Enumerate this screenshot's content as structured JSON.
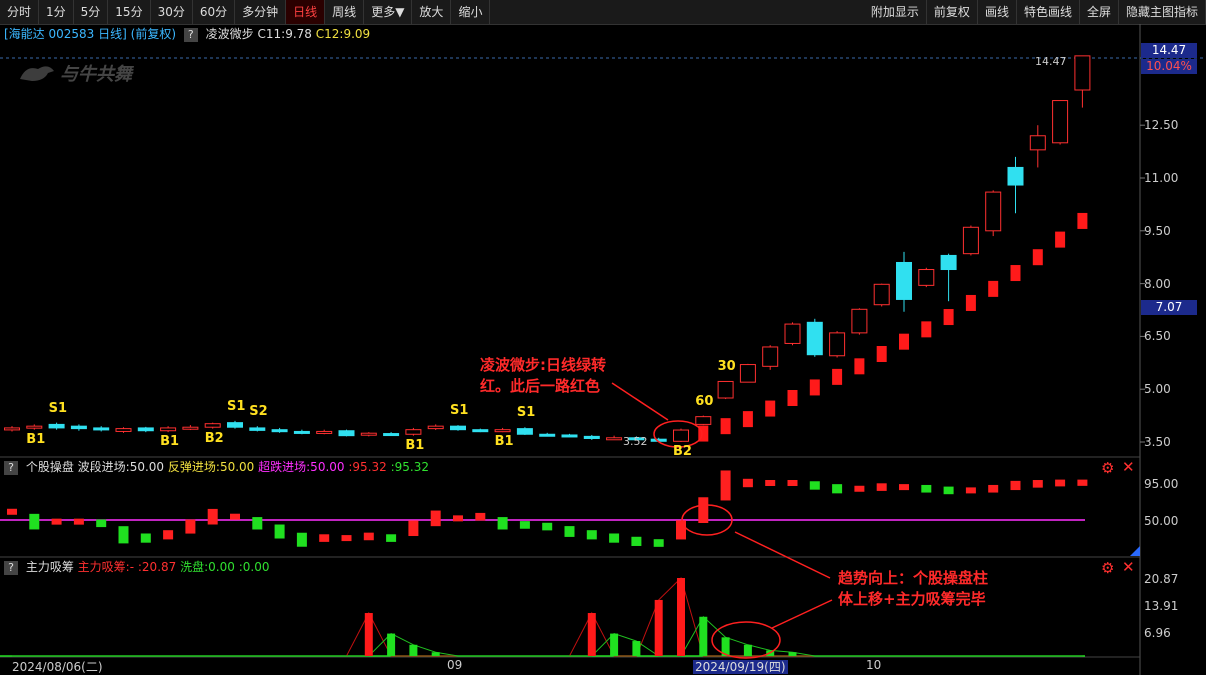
{
  "toolbar": {
    "left": [
      "分时",
      "1分",
      "5分",
      "15分",
      "30分",
      "60分",
      "多分钟",
      "日线",
      "周线",
      "更多▼",
      "放大",
      "缩小"
    ],
    "right": [
      "附加显示",
      "前复权",
      "画线",
      "特色画线",
      "全屏",
      "隐藏主图指标"
    ],
    "active": "日线"
  },
  "header": {
    "stock": "[海能达 002583 日线]",
    "adjust": "(前复权)",
    "help": "?",
    "indicator": "凌波微步",
    "c11": "C11:9.78",
    "c12": "C12:9.09"
  },
  "watermark": "与牛共舞",
  "price_axis": {
    "ticks": [
      "12.50",
      "11.00",
      "9.50",
      "8.00",
      "6.50",
      "5.00",
      "3.50"
    ],
    "top_price": "14.47",
    "top_pct": "10.04%",
    "current": "7.07",
    "high_label": "14.47",
    "low_label": "3.52"
  },
  "main_markers": [
    {
      "text": "B1",
      "i": 1,
      "row": "low"
    },
    {
      "text": "S1",
      "i": 2,
      "row": "high"
    },
    {
      "text": "B1",
      "i": 7,
      "row": "low"
    },
    {
      "text": "B2",
      "i": 9,
      "row": "low"
    },
    {
      "text": "S1",
      "i": 10,
      "row": "high"
    },
    {
      "text": "S2",
      "i": 11,
      "row": "high"
    },
    {
      "text": "B1",
      "i": 18,
      "row": "low"
    },
    {
      "text": "S1",
      "i": 20,
      "row": "high"
    },
    {
      "text": "B1",
      "i": 22,
      "row": "low"
    },
    {
      "text": "S1",
      "i": 23,
      "row": "high"
    },
    {
      "text": "B2",
      "i": 30,
      "row": "low"
    },
    {
      "text": "60",
      "i": 31,
      "row": "high"
    },
    {
      "text": "30",
      "i": 32,
      "row": "high"
    }
  ],
  "annotation_top": [
    "凌波微步:日线绿转",
    "红。此后一路红色"
  ],
  "annotation_bottom": [
    "趋势向上：个股操盘柱",
    "体上移+主力吸筹完毕"
  ],
  "pane2": {
    "help": "?",
    "name": "个股操盘",
    "l1": "波段进场:50.00",
    "l2": "反弹进场:50.00",
    "l3": "超跌进场:50.00",
    "l4": ":95.32",
    "l5": ":95.32",
    "ticks": [
      "95.00",
      "50.00"
    ]
  },
  "pane3": {
    "help": "?",
    "name": "主力吸筹",
    "l1": "主力吸筹:-",
    "l2": ":20.87",
    "l3": "洗盘:0.00",
    "l4": ":0.00",
    "ticks": [
      "20.87",
      "13.91",
      "6.96"
    ]
  },
  "dates": {
    "d1": "2024/08/06(二)",
    "d2": "09",
    "d3": "2024/09/19(四)",
    "d4": "10"
  },
  "colors": {
    "up": "#ff3030",
    "down": "#30e0f0",
    "green": "#30e030",
    "magenta": "#ff30ff"
  },
  "chart_data": {
    "type": "candlestick",
    "candles": [
      [
        3.85,
        3.9,
        3.8,
        3.95
      ],
      [
        3.9,
        3.95,
        3.85,
        4.0
      ],
      [
        4.0,
        3.9,
        3.85,
        4.05
      ],
      [
        3.95,
        3.88,
        3.82,
        4.0
      ],
      [
        3.9,
        3.85,
        3.8,
        3.95
      ],
      [
        3.8,
        3.88,
        3.76,
        3.92
      ],
      [
        3.9,
        3.82,
        3.78,
        3.93
      ],
      [
        3.82,
        3.9,
        3.78,
        3.95
      ],
      [
        3.88,
        3.92,
        3.84,
        3.98
      ],
      [
        3.92,
        4.02,
        3.88,
        4.05
      ],
      [
        4.05,
        3.92,
        3.88,
        4.1
      ],
      [
        3.9,
        3.83,
        3.8,
        3.95
      ],
      [
        3.85,
        3.8,
        3.76,
        3.9
      ],
      [
        3.8,
        3.75,
        3.72,
        3.85
      ],
      [
        3.76,
        3.8,
        3.72,
        3.85
      ],
      [
        3.82,
        3.68,
        3.66,
        3.85
      ],
      [
        3.7,
        3.75,
        3.66,
        3.78
      ],
      [
        3.74,
        3.7,
        3.68,
        3.78
      ],
      [
        3.72,
        3.85,
        3.68,
        3.9
      ],
      [
        3.88,
        3.95,
        3.84,
        4.0
      ],
      [
        3.95,
        3.85,
        3.82,
        3.98
      ],
      [
        3.85,
        3.82,
        3.78,
        3.88
      ],
      [
        3.82,
        3.85,
        3.78,
        3.9
      ],
      [
        3.88,
        3.72,
        3.7,
        3.92
      ],
      [
        3.72,
        3.7,
        3.66,
        3.76
      ],
      [
        3.7,
        3.67,
        3.64,
        3.73
      ],
      [
        3.66,
        3.6,
        3.56,
        3.7
      ],
      [
        3.6,
        3.62,
        3.56,
        3.68
      ],
      [
        3.62,
        3.58,
        3.54,
        3.66
      ],
      [
        3.58,
        3.52,
        3.52,
        3.62
      ],
      [
        3.52,
        3.84,
        3.5,
        3.88
      ],
      [
        4.0,
        4.22,
        3.98,
        4.25
      ],
      [
        4.75,
        5.22,
        4.72,
        5.22
      ],
      [
        5.2,
        5.7,
        5.2,
        5.72
      ],
      [
        5.65,
        6.2,
        5.55,
        6.25
      ],
      [
        6.3,
        6.85,
        6.25,
        6.9
      ],
      [
        6.9,
        5.98,
        5.92,
        7.0
      ],
      [
        5.95,
        6.6,
        5.9,
        6.65
      ],
      [
        6.6,
        7.27,
        6.55,
        7.3
      ],
      [
        7.4,
        7.98,
        7.35,
        8.0
      ],
      [
        8.6,
        7.55,
        7.2,
        8.9
      ],
      [
        7.95,
        8.4,
        7.9,
        8.45
      ],
      [
        8.8,
        8.4,
        7.5,
        8.85
      ],
      [
        8.85,
        9.6,
        8.8,
        9.65
      ],
      [
        9.5,
        10.6,
        9.35,
        10.65
      ],
      [
        11.3,
        10.8,
        10.0,
        11.6
      ],
      [
        11.8,
        12.2,
        11.3,
        12.5
      ],
      [
        12.0,
        13.2,
        11.95,
        13.2
      ],
      [
        13.5,
        14.47,
        13.0,
        14.47
      ]
    ],
    "indicator_c12": [
      3.72,
      3.74,
      3.75,
      3.75,
      3.74,
      3.73,
      3.73,
      3.74,
      3.75,
      3.77,
      3.78,
      3.77,
      3.76,
      3.74,
      3.73,
      3.71,
      3.7,
      3.7,
      3.71,
      3.73,
      3.74,
      3.74,
      3.74,
      3.73,
      3.71,
      3.69,
      3.66,
      3.64,
      3.62,
      3.59,
      3.62,
      3.74,
      3.95,
      4.15,
      4.45,
      4.75,
      5.05,
      5.35,
      5.65,
      6.0,
      6.35,
      6.7,
      7.05,
      7.45,
      7.85,
      8.3,
      8.75,
      9.25,
      9.78
    ],
    "pane2_values": [
      60,
      48,
      48,
      48,
      46,
      32,
      28,
      32,
      42,
      54,
      54,
      46,
      36,
      26,
      28,
      28,
      30,
      28,
      40,
      52,
      52,
      54,
      46,
      44,
      42,
      36,
      32,
      28,
      24,
      22,
      38,
      62,
      92,
      95,
      95,
      95,
      92,
      88,
      88,
      90,
      90,
      88,
      86,
      86,
      88,
      92,
      94,
      95,
      95.32
    ],
    "pane3_main": [
      0,
      0,
      0,
      0,
      0,
      0,
      0,
      0,
      0,
      0,
      0,
      0,
      0,
      0,
      0,
      0,
      11.5,
      0,
      0,
      0,
      0,
      0,
      0,
      0,
      0,
      0,
      11.5,
      0,
      0,
      15,
      20.87,
      0,
      0,
      0,
      0,
      0,
      0,
      0,
      0,
      0,
      0,
      0,
      0,
      0,
      0,
      0,
      0,
      0,
      0
    ],
    "pane3_green": [
      0,
      0,
      0,
      0,
      0,
      0,
      0,
      0,
      0,
      0,
      0,
      0,
      0,
      0,
      0,
      0,
      0,
      6,
      3,
      1,
      0,
      0,
      0,
      0,
      0,
      0,
      0,
      6,
      4,
      0,
      0,
      10.5,
      5,
      3,
      1.5,
      1,
      0,
      0,
      0,
      0,
      0,
      0,
      0,
      0,
      0,
      0,
      0,
      0,
      0
    ]
  }
}
